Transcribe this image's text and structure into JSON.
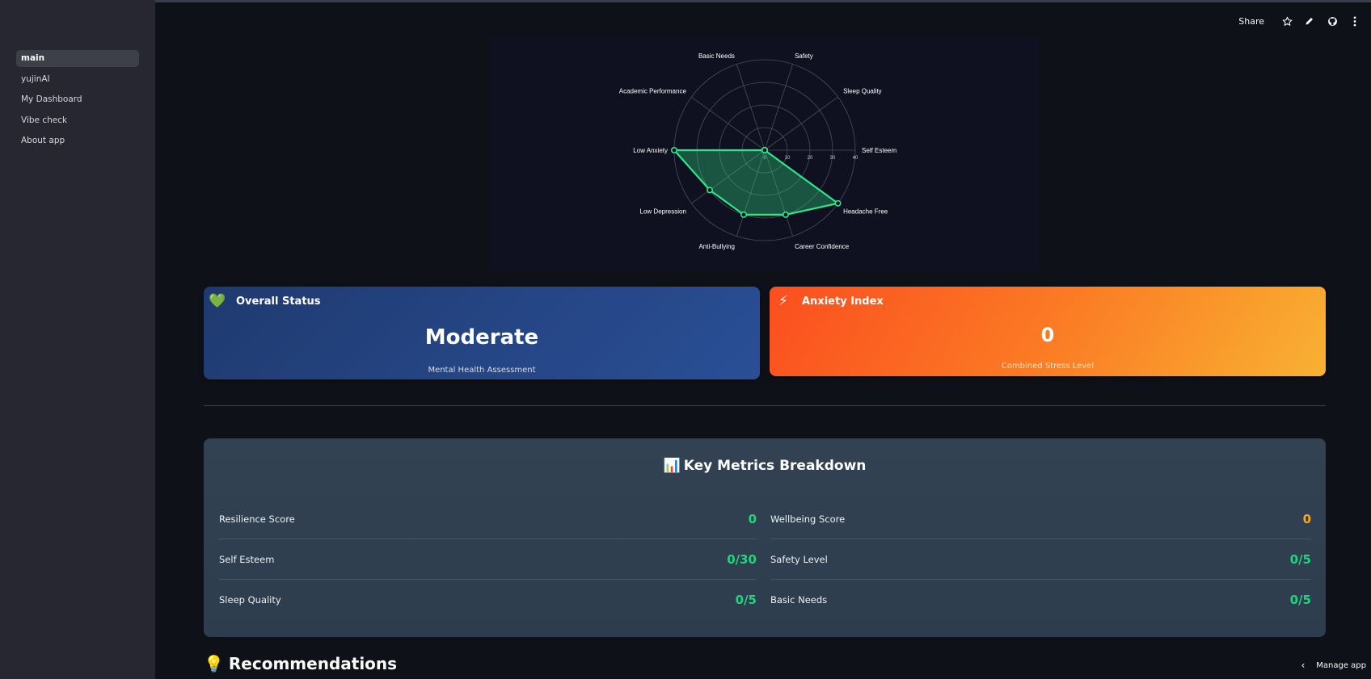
{
  "sidebar": {
    "items": [
      {
        "label": "main",
        "active": true
      },
      {
        "label": "yujinAI"
      },
      {
        "label": "My Dashboard"
      },
      {
        "label": "Vibe check"
      },
      {
        "label": "About app"
      }
    ]
  },
  "header": {
    "share_label": "Share",
    "icons": [
      "star-icon",
      "pencil-icon",
      "github-icon",
      "kebab-menu-icon"
    ]
  },
  "chart_data": {
    "type": "radar",
    "categories": [
      "Self Esteem",
      "Headache Free",
      "Career Confidence",
      "Anti-Bullying",
      "Low Depression",
      "Low Anxiety",
      "Academic Performance",
      "Basic Needs",
      "Safety",
      "Sleep Quality"
    ],
    "series": [
      {
        "values": [
          0,
          40,
          30,
          30,
          30,
          40,
          0,
          0,
          0,
          0
        ],
        "color": "#2fe58a"
      }
    ],
    "radial_ticks": [
      "0",
      "10",
      "20",
      "30",
      "40"
    ],
    "rlim": [
      0,
      40
    ]
  },
  "cards": {
    "status": {
      "emoji": "💚",
      "title": "Overall Status",
      "value": "Moderate",
      "sub": "Mental Health Assessment"
    },
    "anxiety": {
      "emoji": "⚡",
      "title": "Anxiety Index",
      "value": "0",
      "sub": "Combined Stress Level"
    }
  },
  "metrics": {
    "emoji": "📊",
    "title": "Key Metrics Breakdown",
    "left": [
      {
        "label": "Resilience Score",
        "value": "0"
      },
      {
        "label": "Self Esteem",
        "value": "0/30"
      },
      {
        "label": "Sleep Quality",
        "value": "0/5"
      }
    ],
    "right": [
      {
        "label": "Wellbeing Score",
        "value": "0"
      },
      {
        "label": "Safety Level",
        "value": "0/5"
      },
      {
        "label": "Basic Needs",
        "value": "0/5"
      }
    ]
  },
  "recommendations": {
    "emoji": "💡",
    "title": "Recommendations"
  },
  "manage_app": {
    "label": "Manage app"
  },
  "colors": {
    "accent_green": "#22d37d",
    "amber": "#f6a821",
    "status_blue": "#2a4f96",
    "anxiety_orange": "#fb6a22"
  }
}
